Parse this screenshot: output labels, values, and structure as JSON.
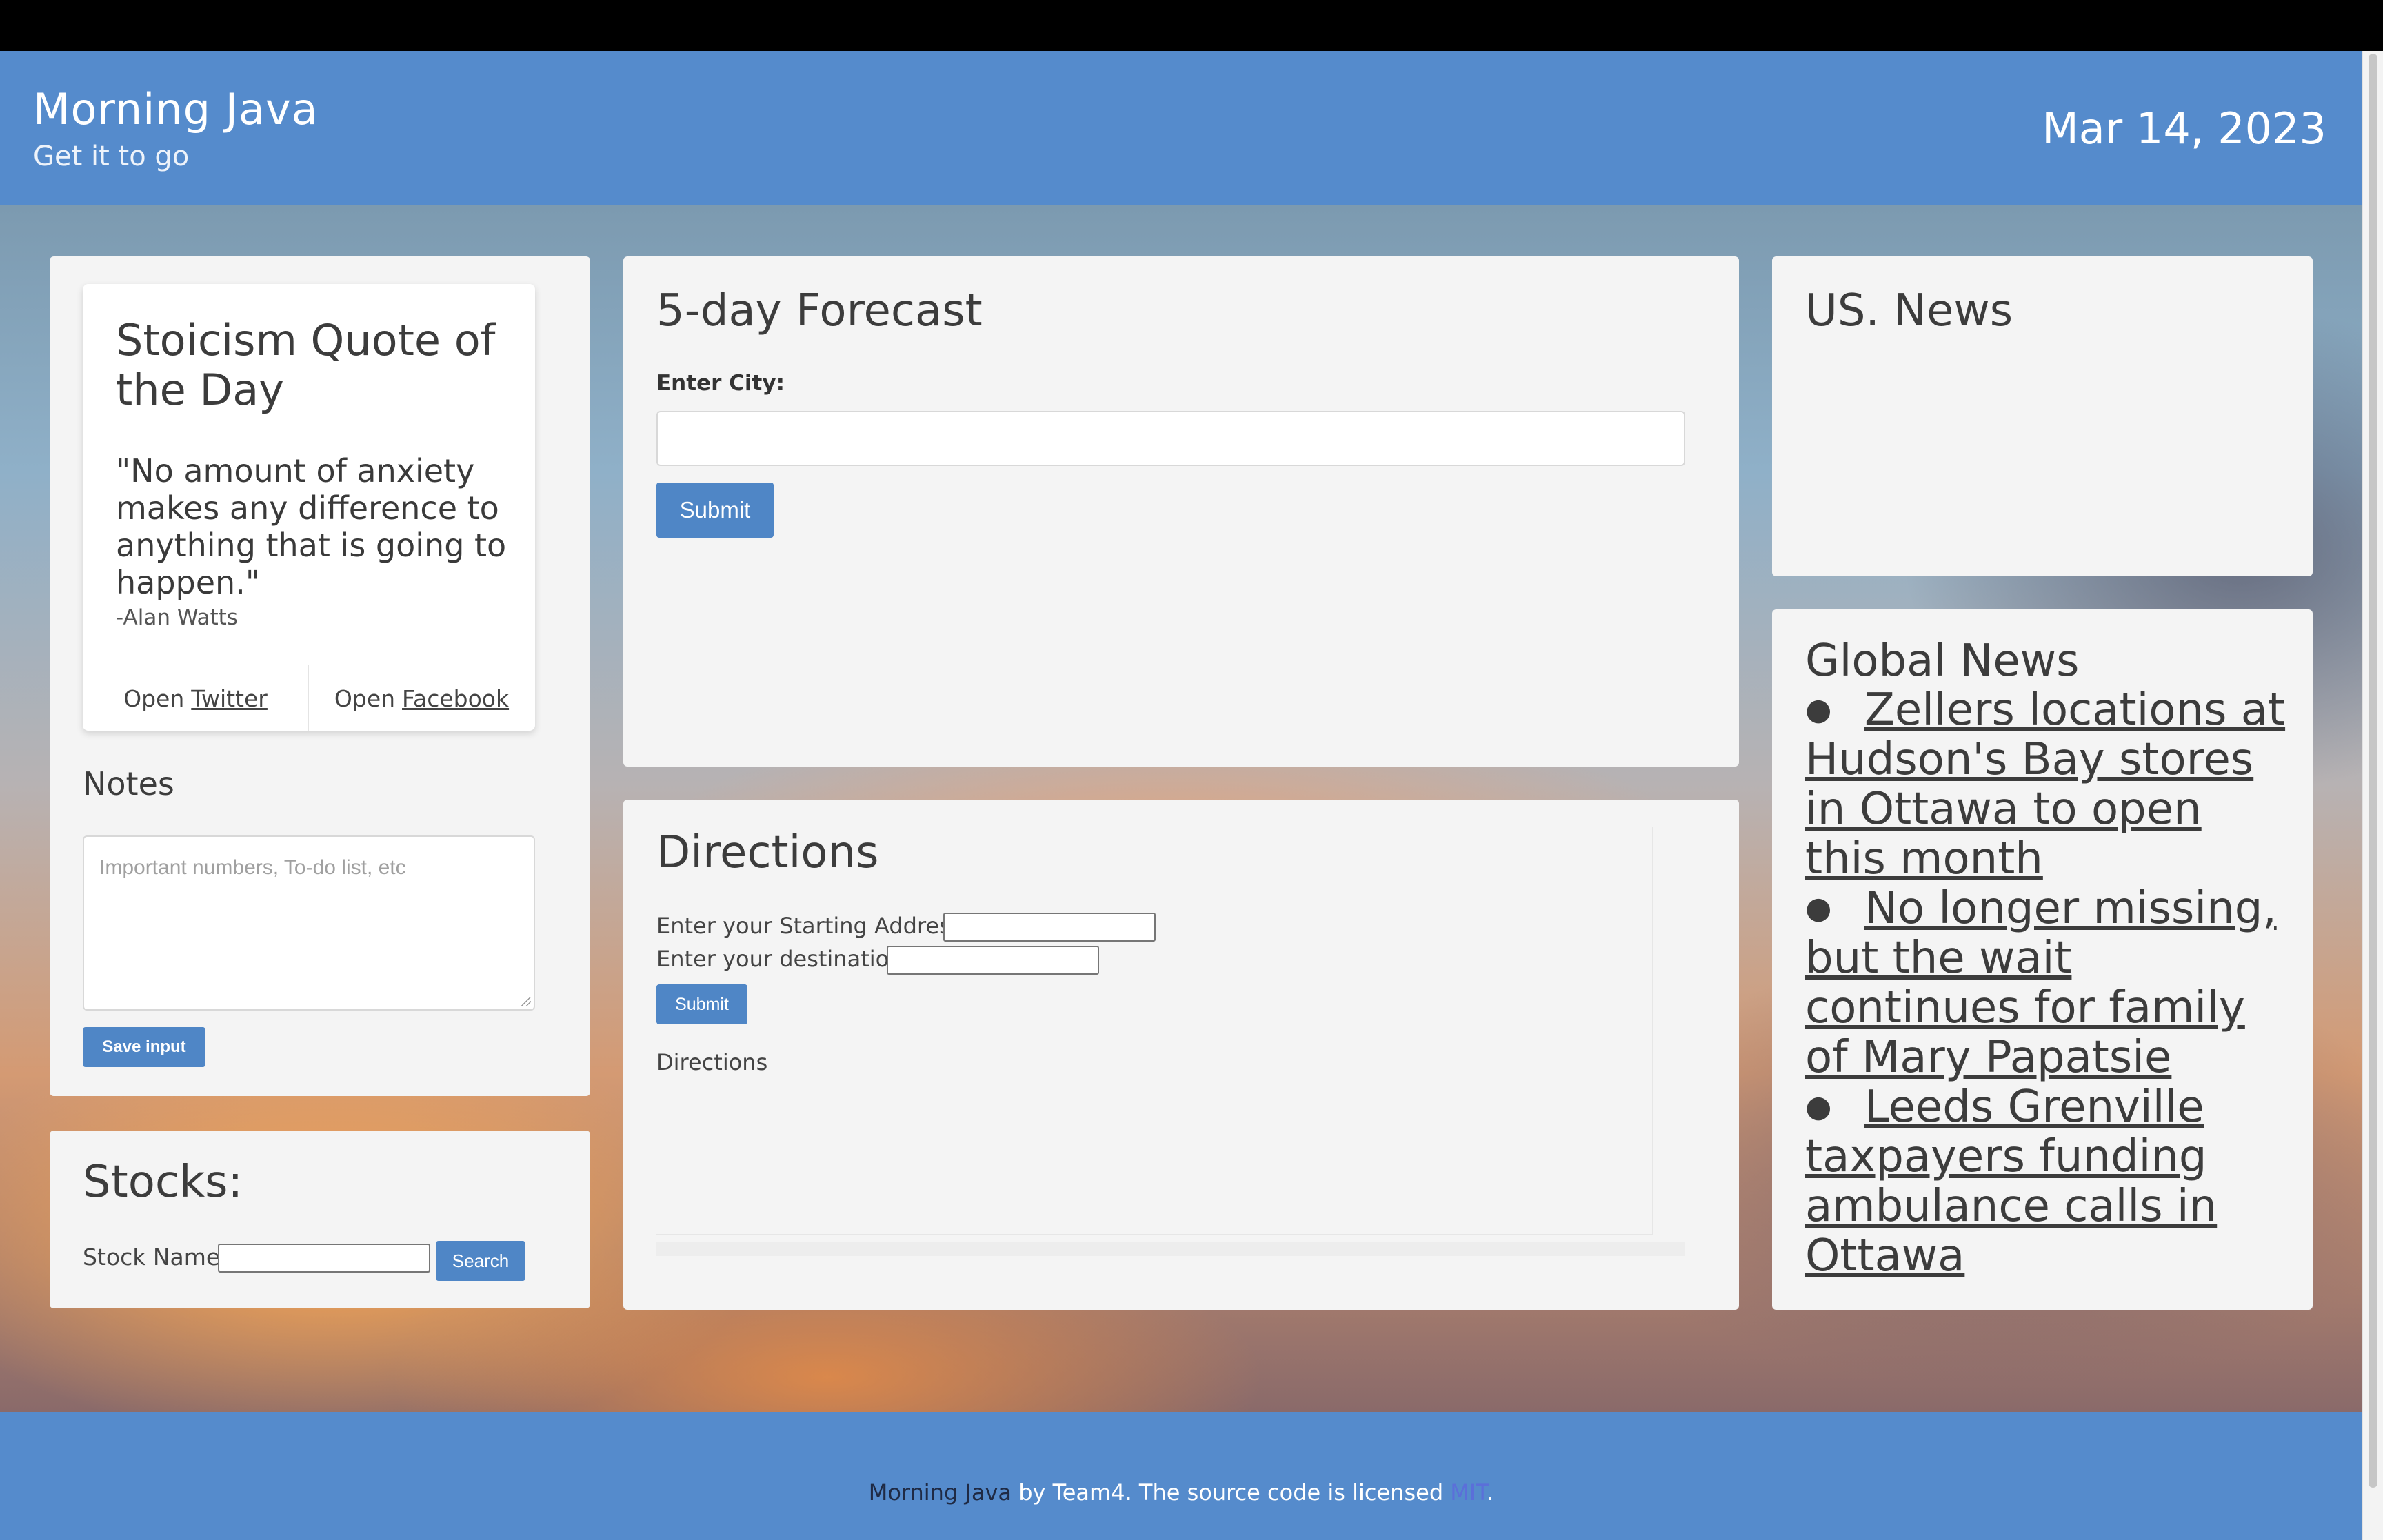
{
  "header": {
    "title": "Morning Java",
    "tagline": "Get it to go",
    "date": "Mar 14, 2023"
  },
  "quote": {
    "title": "Stoicism Quote of the Day",
    "text": "\"No amount of anxiety makes any difference to anything that is going to happen.\"",
    "author": "-Alan Watts",
    "share_twitter_prefix": "Open",
    "share_twitter_link": "Twitter",
    "share_facebook_prefix": "Open",
    "share_facebook_link": "Facebook"
  },
  "notes": {
    "title": "Notes",
    "placeholder": "Important numbers, To-do list, etc",
    "save_label": "Save input"
  },
  "stocks": {
    "title": "Stocks:",
    "label": "Stock Name:",
    "search_label": "Search"
  },
  "forecast": {
    "title": "5-day Forecast",
    "city_label": "Enter City:",
    "submit_label": "Submit"
  },
  "directions": {
    "title": "Directions",
    "start_label": "Enter your Starting Address",
    "destination_label": "Enter your destination",
    "submit_label": "Submit",
    "output_label": "Directions"
  },
  "us_news": {
    "title": "US. News"
  },
  "global_news": {
    "title": "Global News",
    "items": [
      "Zellers locations at Hudson's Bay stores in Ottawa to open this month",
      "No longer missing, but the wait continues for family of Mary Papatsie",
      "Leeds Grenville taxpayers funding ambulance calls in Ottawa"
    ]
  },
  "footer": {
    "brand": "Morning Java",
    "middle": " by Team4. The source code is licensed ",
    "license": "MIT",
    "end": "."
  },
  "colors": {
    "header_bg": "#558bcc",
    "button_bg": "#4f86c6",
    "card_bg": "#f4f4f4",
    "license_link": "#5b6fd9"
  },
  "icons": {
    "news_bullet": "bullet-icon"
  }
}
